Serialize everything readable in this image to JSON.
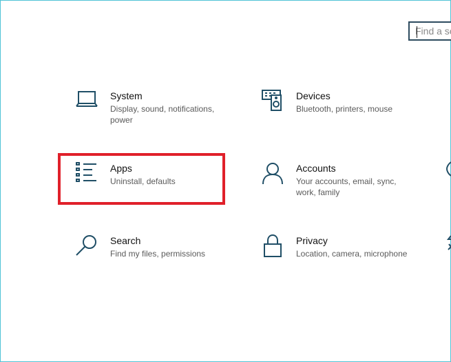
{
  "search": {
    "placeholder": "Find a setting"
  },
  "tiles": {
    "system": {
      "title": "System",
      "desc": "Display, sound, notifications, power",
      "icon": "laptop-icon"
    },
    "devices": {
      "title": "Devices",
      "desc": "Bluetooth, printers, mouse",
      "icon": "devices-icon"
    },
    "apps": {
      "title": "Apps",
      "desc": "Uninstall, defaults",
      "icon": "apps-list-icon"
    },
    "accounts": {
      "title": "Accounts",
      "desc": "Your accounts, email, sync, work, family",
      "icon": "person-icon"
    },
    "search": {
      "title": "Search",
      "desc": "Find my files, permissions",
      "icon": "search-icon"
    },
    "privacy": {
      "title": "Privacy",
      "desc": "Location, camera, microphone",
      "icon": "lock-icon"
    }
  },
  "colors": {
    "icon": "#1f4e66",
    "highlight": "#e0202a",
    "frame": "#4fc3d6"
  }
}
